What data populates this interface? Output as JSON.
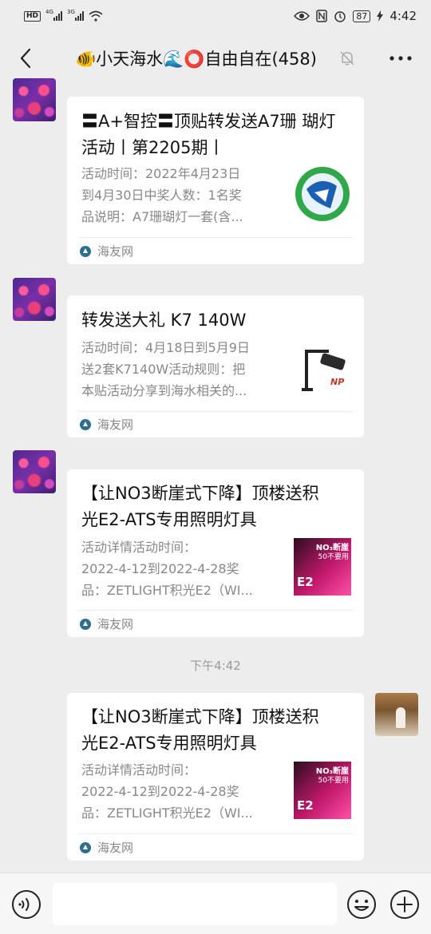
{
  "status_bar": {
    "hd": "HD",
    "net1": "4G",
    "net2": "3G",
    "battery": "87",
    "time": "4:42"
  },
  "header": {
    "title": "🐠小天海水🌊⭕自由自在(458)"
  },
  "messages": [
    {
      "title": "〓A+智控〓顶贴转发送A7珊 瑚灯活动丨第2205期丨",
      "title_line1": "〓A+智控〓顶贴转发送A7珊 瑚灯",
      "title_line2": "活动丨第2205期丨",
      "desc_line1": "活动时间：2022年4月23日",
      "desc_line2": "到4月30日中奖人数：1名奖",
      "desc_line3": "品说明：A7珊瑚灯一套(含...",
      "source": "海友网"
    },
    {
      "title_line1": "转发送大礼 K7 140W",
      "desc_line1": "活动时间：4月18日到5月9日",
      "desc_line2": "送2套K7140W活动规则：把",
      "desc_line3": "本贴活动分享到海水相关的...",
      "thumb_text": "NP",
      "source": "海友网"
    },
    {
      "title_line1": "【让NO3断崖式下降】顶楼送积",
      "title_line2": "光E2-ATS专用照明灯具",
      "desc_line1": "活动详情活动时间：",
      "desc_line2": "2022-4-12到2022-4-28奖",
      "desc_line3": "品：ZETLIGHT积光E2（WI...",
      "thumb_text1": "NO₃断崖",
      "thumb_text2": "50不要用",
      "thumb_text3": "E2",
      "source": "海友网"
    },
    {
      "title_line1": "【让NO3断崖式下降】顶楼送积",
      "title_line2": "光E2-ATS专用照明灯具",
      "desc_line1": "活动详情活动时间：",
      "desc_line2": "2022-4-12到2022-4-28奖",
      "desc_line3": "品：ZETLIGHT积光E2（WI...",
      "thumb_text1": "NO₃断崖",
      "thumb_text2": "50不要用",
      "thumb_text3": "E2",
      "source": "海友网"
    }
  ],
  "timestamp": "下午4:42",
  "input": {
    "value": ""
  }
}
